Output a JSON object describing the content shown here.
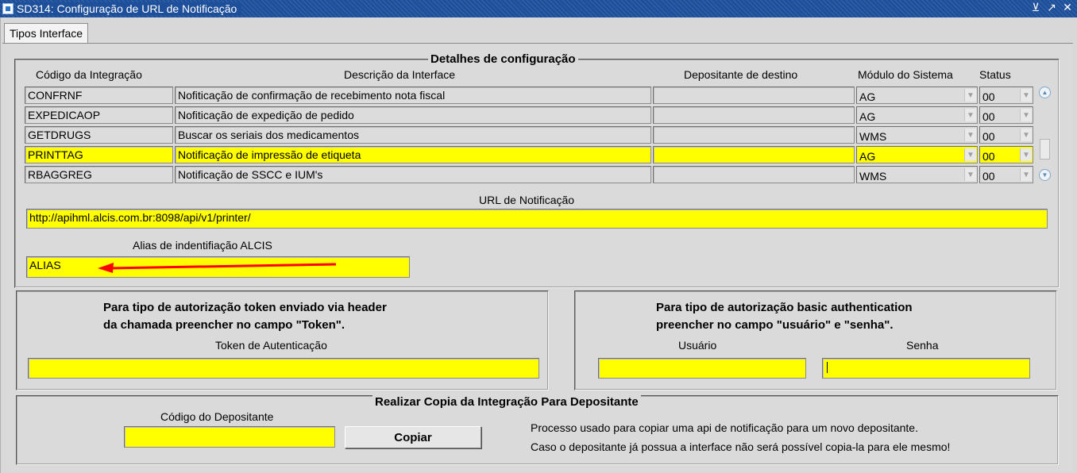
{
  "window": {
    "title": "SD314: Configuração de URL de Notificação",
    "controls": [
      "⊻",
      "↗",
      "✕"
    ]
  },
  "tab": {
    "label": "Tipos Interface"
  },
  "details": {
    "title": "Detalhes de configuração",
    "columns": {
      "codigo": "Código da Integração",
      "descricao": "Descrição da Interface",
      "depositante": "Depositante de destino",
      "modulo": "Módulo do Sistema",
      "status": "Status"
    },
    "rows": [
      {
        "codigo": "CONFRNF",
        "descricao": "Nofiticação de confirmação de recebimento nota fiscal",
        "depositante": "",
        "modulo": "AG",
        "status": "00",
        "selected": false
      },
      {
        "codigo": "EXPEDICAOP",
        "descricao": "Nofiticação de expedição de pedido",
        "depositante": "",
        "modulo": "AG",
        "status": "00",
        "selected": false
      },
      {
        "codigo": "GETDRUGS",
        "descricao": "Buscar os seriais dos medicamentos",
        "depositante": "",
        "modulo": "WMS",
        "status": "00",
        "selected": false
      },
      {
        "codigo": "PRINTTAG",
        "descricao": "Notificação de impressão de etiqueta",
        "depositante": "",
        "modulo": "AG",
        "status": "00",
        "selected": true
      },
      {
        "codigo": "RBAGGREG",
        "descricao": "Notificação de SSCC e IUM's",
        "depositante": "",
        "modulo": "WMS",
        "status": "00",
        "selected": false
      }
    ],
    "url_label": "URL de Notificação",
    "url_value": "http://apihml.alcis.com.br:8098/api/v1/printer/",
    "alias_label": "Alias de indentifiação ALCIS",
    "alias_value": "ALIAS"
  },
  "token_box": {
    "line1": "Para tipo de autorização token enviado via header",
    "line2": "da chamada preencher no campo \"Token\".",
    "token_label": "Token de Autenticação",
    "token_value": ""
  },
  "basic_box": {
    "line1": "Para tipo de autorização basic authentication",
    "line2": "preencher no campo \"usuário\" e \"senha\".",
    "user_label": "Usuário",
    "user_value": "",
    "password_label": "Senha",
    "password_value": ""
  },
  "copy_box": {
    "title": "Realizar Copia da Integração Para Depositante",
    "depositante_label": "Código do Depositante",
    "depositante_value": "",
    "button_label": "Copiar",
    "info_line1": "Processo usado para copiar uma api de notificação para um novo depositante.",
    "info_line2": "Caso o depositante já possua a interface não será possível copia-la para ele mesmo!"
  },
  "colors": {
    "highlight": "#ffff00",
    "titlebar": "#1d4f9a",
    "arrow": "#ff0000"
  }
}
